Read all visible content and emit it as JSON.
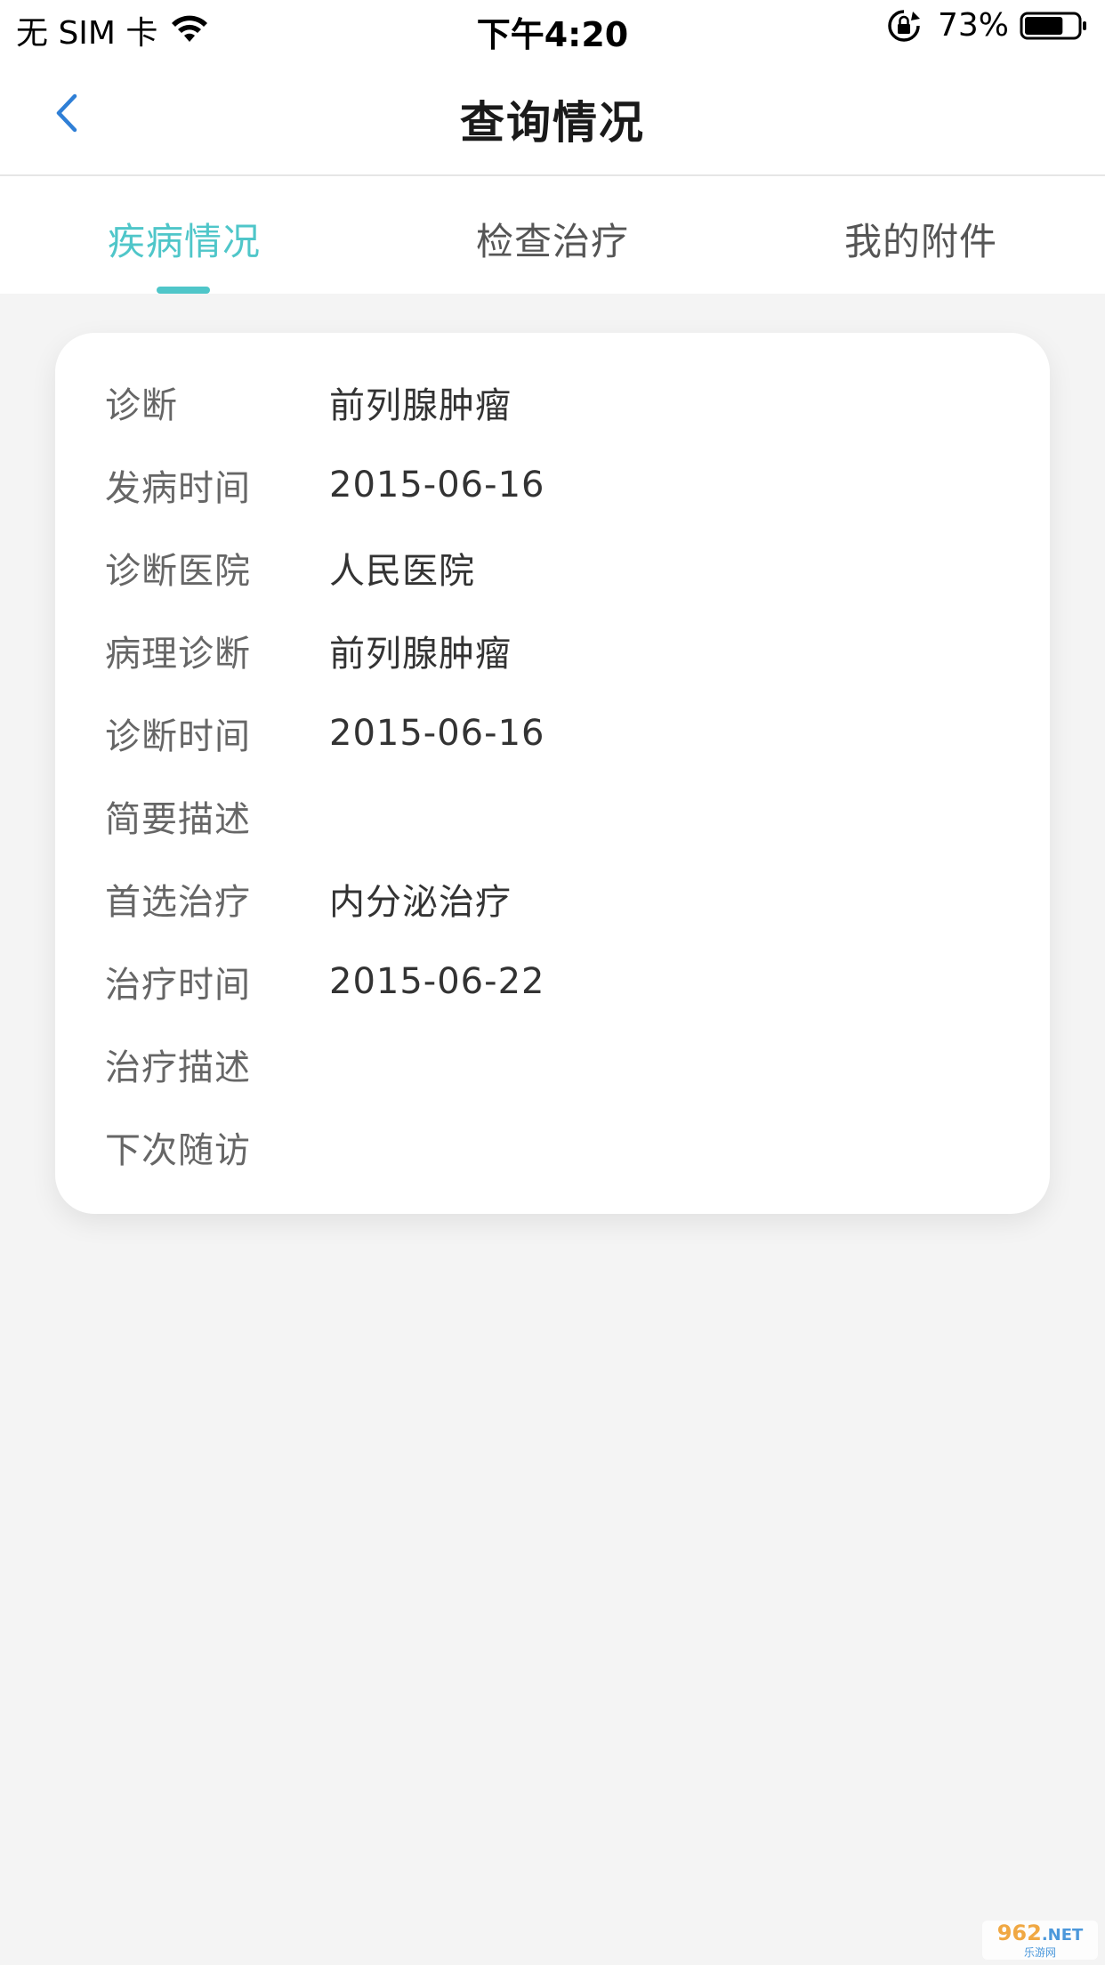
{
  "status_bar": {
    "carrier": "无 SIM 卡",
    "time": "下午4:20",
    "battery": "73%",
    "battery_level": 0.73,
    "icons": [
      "wifi-icon",
      "lock-rotation-icon",
      "battery-icon"
    ]
  },
  "nav": {
    "title": "查询情况",
    "back_icon": "chevron-left-icon",
    "accent_color": "#2f7fd6"
  },
  "tabs": [
    {
      "label": "疾病情况",
      "active": true
    },
    {
      "label": "检查治疗",
      "active": false
    },
    {
      "label": "我的附件",
      "active": false
    }
  ],
  "theme": {
    "tab_active_color": "#4fc6c9",
    "background": "#f4f4f4"
  },
  "details": [
    {
      "label": "诊断",
      "value": "前列腺肿瘤"
    },
    {
      "label": "发病时间",
      "value": "2015-06-16"
    },
    {
      "label": "诊断医院",
      "value": "人民医院"
    },
    {
      "label": "病理诊断",
      "value": "前列腺肿瘤"
    },
    {
      "label": "诊断时间",
      "value": "2015-06-16"
    },
    {
      "label": "简要描述",
      "value": ""
    },
    {
      "label": "首选治疗",
      "value": "内分泌治疗"
    },
    {
      "label": "治疗时间",
      "value": "2015-06-22"
    },
    {
      "label": "治疗描述",
      "value": ""
    },
    {
      "label": "下次随访",
      "value": ""
    }
  ],
  "watermark": {
    "main": "962",
    "suffix": ".NET",
    "sub": "乐游网"
  }
}
